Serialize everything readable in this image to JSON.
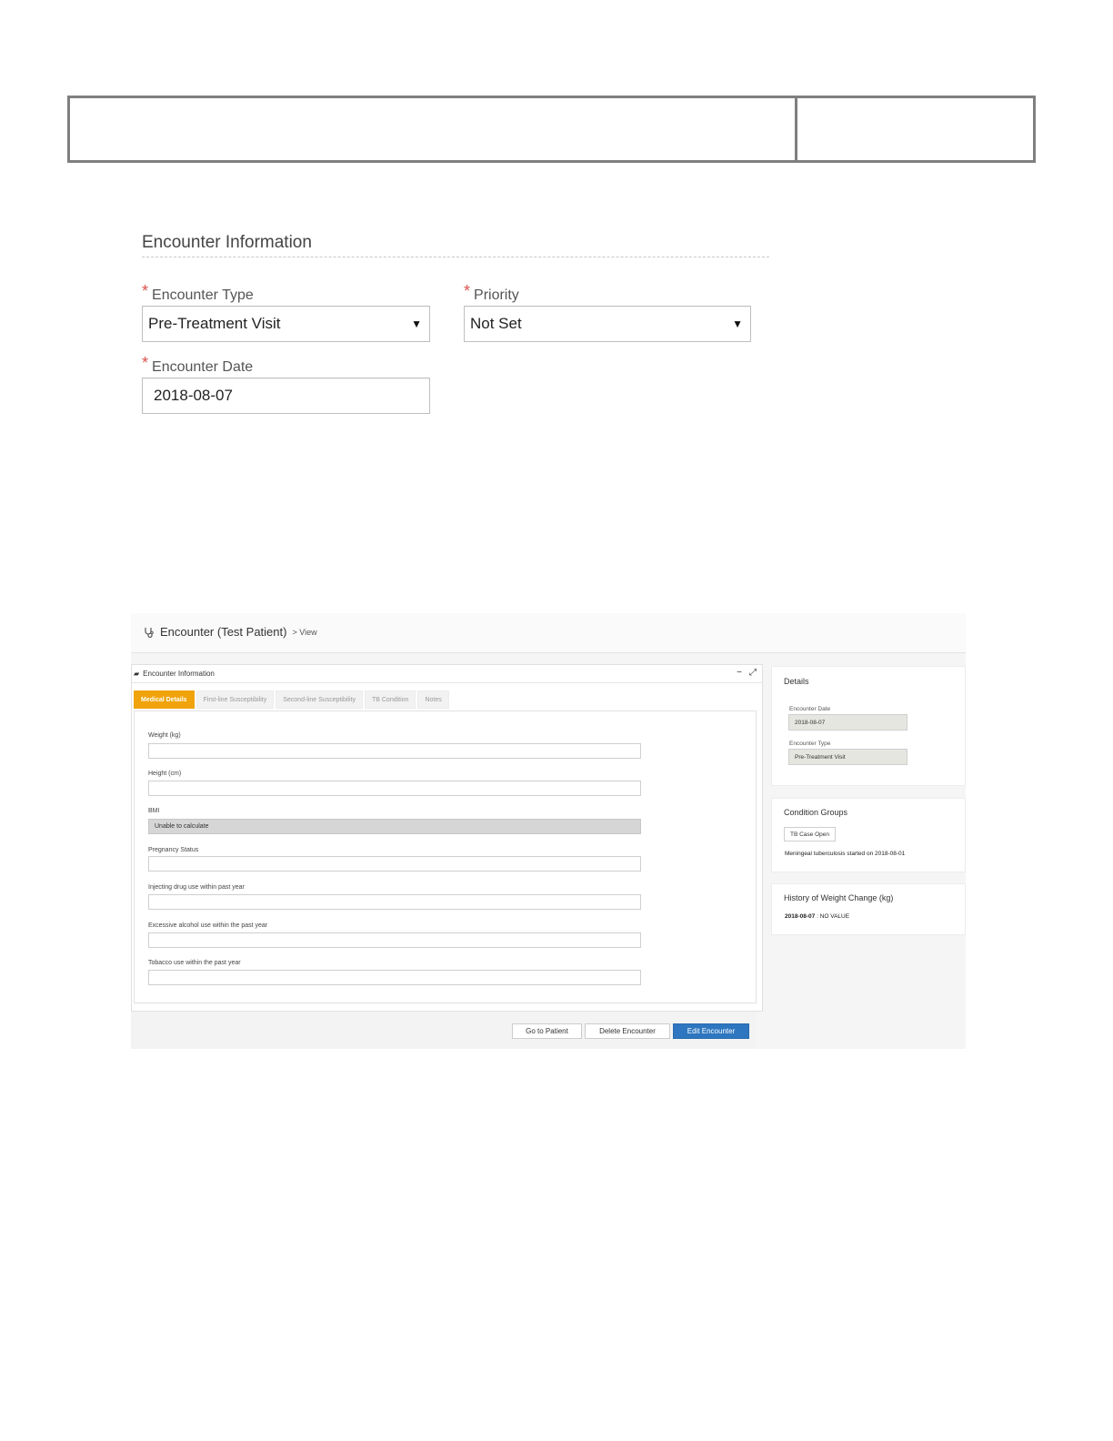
{
  "encounter_form": {
    "section_title": "Encounter Information",
    "required_marker": "*",
    "encounter_type": {
      "label": "Encounter Type",
      "value": "Pre-Treatment Visit"
    },
    "priority": {
      "label": "Priority",
      "value": "Not Set"
    },
    "encounter_date": {
      "label": "Encounter Date",
      "value": "2018-08-07"
    },
    "dropdown_arrow": "▼"
  },
  "screenshot": {
    "header": {
      "title": "Encounter (Test Patient)",
      "breadcrumb": "> View",
      "icon": "stethoscope-icon"
    },
    "panel": {
      "title": "Encounter Information",
      "minimize": "−",
      "expand": "⤢",
      "tabs": [
        {
          "label": "Medical Details",
          "active": true
        },
        {
          "label": "First-line Susceptibility",
          "active": false
        },
        {
          "label": "Second-line Susceptibility",
          "active": false
        },
        {
          "label": "TB Condition",
          "active": false
        },
        {
          "label": "Notes",
          "active": false
        }
      ],
      "fields": [
        {
          "label": "Weight (kg)",
          "value": ""
        },
        {
          "label": "Height (cm)",
          "value": ""
        },
        {
          "label": "BMI",
          "value": "Unable to calculate"
        },
        {
          "label": "Pregnancy Status",
          "value": ""
        },
        {
          "label": "Injecting drug use within past year",
          "value": ""
        },
        {
          "label": "Excessive alcohol use within the past year",
          "value": ""
        },
        {
          "label": "Tobacco use within the past year",
          "value": ""
        }
      ]
    },
    "buttons": {
      "go_to_patient": "Go to Patient",
      "delete_encounter": "Delete Encounter",
      "edit_encounter": "Edit Encounter"
    },
    "details_card": {
      "title": "Details",
      "encounter_date_label": "Encounter Date",
      "encounter_date_value": "2018-08-07",
      "encounter_type_label": "Encounter Type",
      "encounter_type_value": "Pre-Treatment Visit"
    },
    "condition_groups": {
      "title": "Condition Groups",
      "tag": "TB Case Open",
      "note": "Meningeal tuberculosis started on 2018-08-01"
    },
    "weight_history": {
      "title": "History of Weight Change (kg)",
      "date": "2018-08-07",
      "separator": ":",
      "value": "NO VALUE"
    },
    "colors": {
      "accent_tab": "#f0a30a",
      "primary_button": "#2e76c0"
    }
  }
}
